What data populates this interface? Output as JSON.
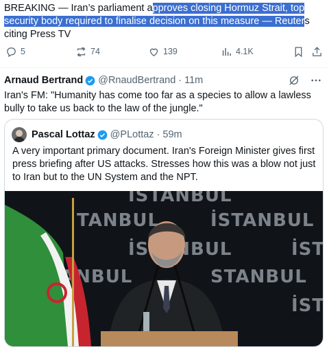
{
  "tweet": {
    "text_before": "BREAKING — Iran’s parliament a",
    "text_highlight": "pproves closing Hormuz Strait, top security body required to finalise decision on this measure — Reuter",
    "text_after": "s citing Press TV"
  },
  "actions": {
    "replies": "5",
    "reposts": "74",
    "likes": "139",
    "views": "4.1K"
  },
  "retweeter": {
    "name": "Arnaud Bertrand",
    "handle": "@RnaudBertrand",
    "sep": "·",
    "time": "11m",
    "text": "Iran's FM: \"Humanity has come too far as a species to allow a lawless bully to take us back to the law of the jungle.\""
  },
  "quoted": {
    "name": "Pascal Lottaz",
    "handle": "@PLottaz",
    "sep": "·",
    "time": "59m",
    "text": "A very important primary document. Iran's Foreign Minister gives first press briefing after US attacks. Stresses how this was a blow not just to Iran but to the UN System and the NPT.",
    "media_words": [
      "ISTANBUL",
      "TANBUL",
      "İSTANBUL",
      "İSTANBUL",
      "NB",
      "İSTA",
      "ANBUL",
      "STANBUL",
      "İSTA"
    ]
  },
  "colors": {
    "highlight": "#3b6fd0",
    "verified": "#1d9bf0",
    "muted": "#536471"
  },
  "icons": [
    "reply-icon",
    "repost-icon",
    "like-icon",
    "views-icon",
    "bookmark-icon",
    "share-icon",
    "verified-badge-icon",
    "grok-icon",
    "more-icon"
  ]
}
